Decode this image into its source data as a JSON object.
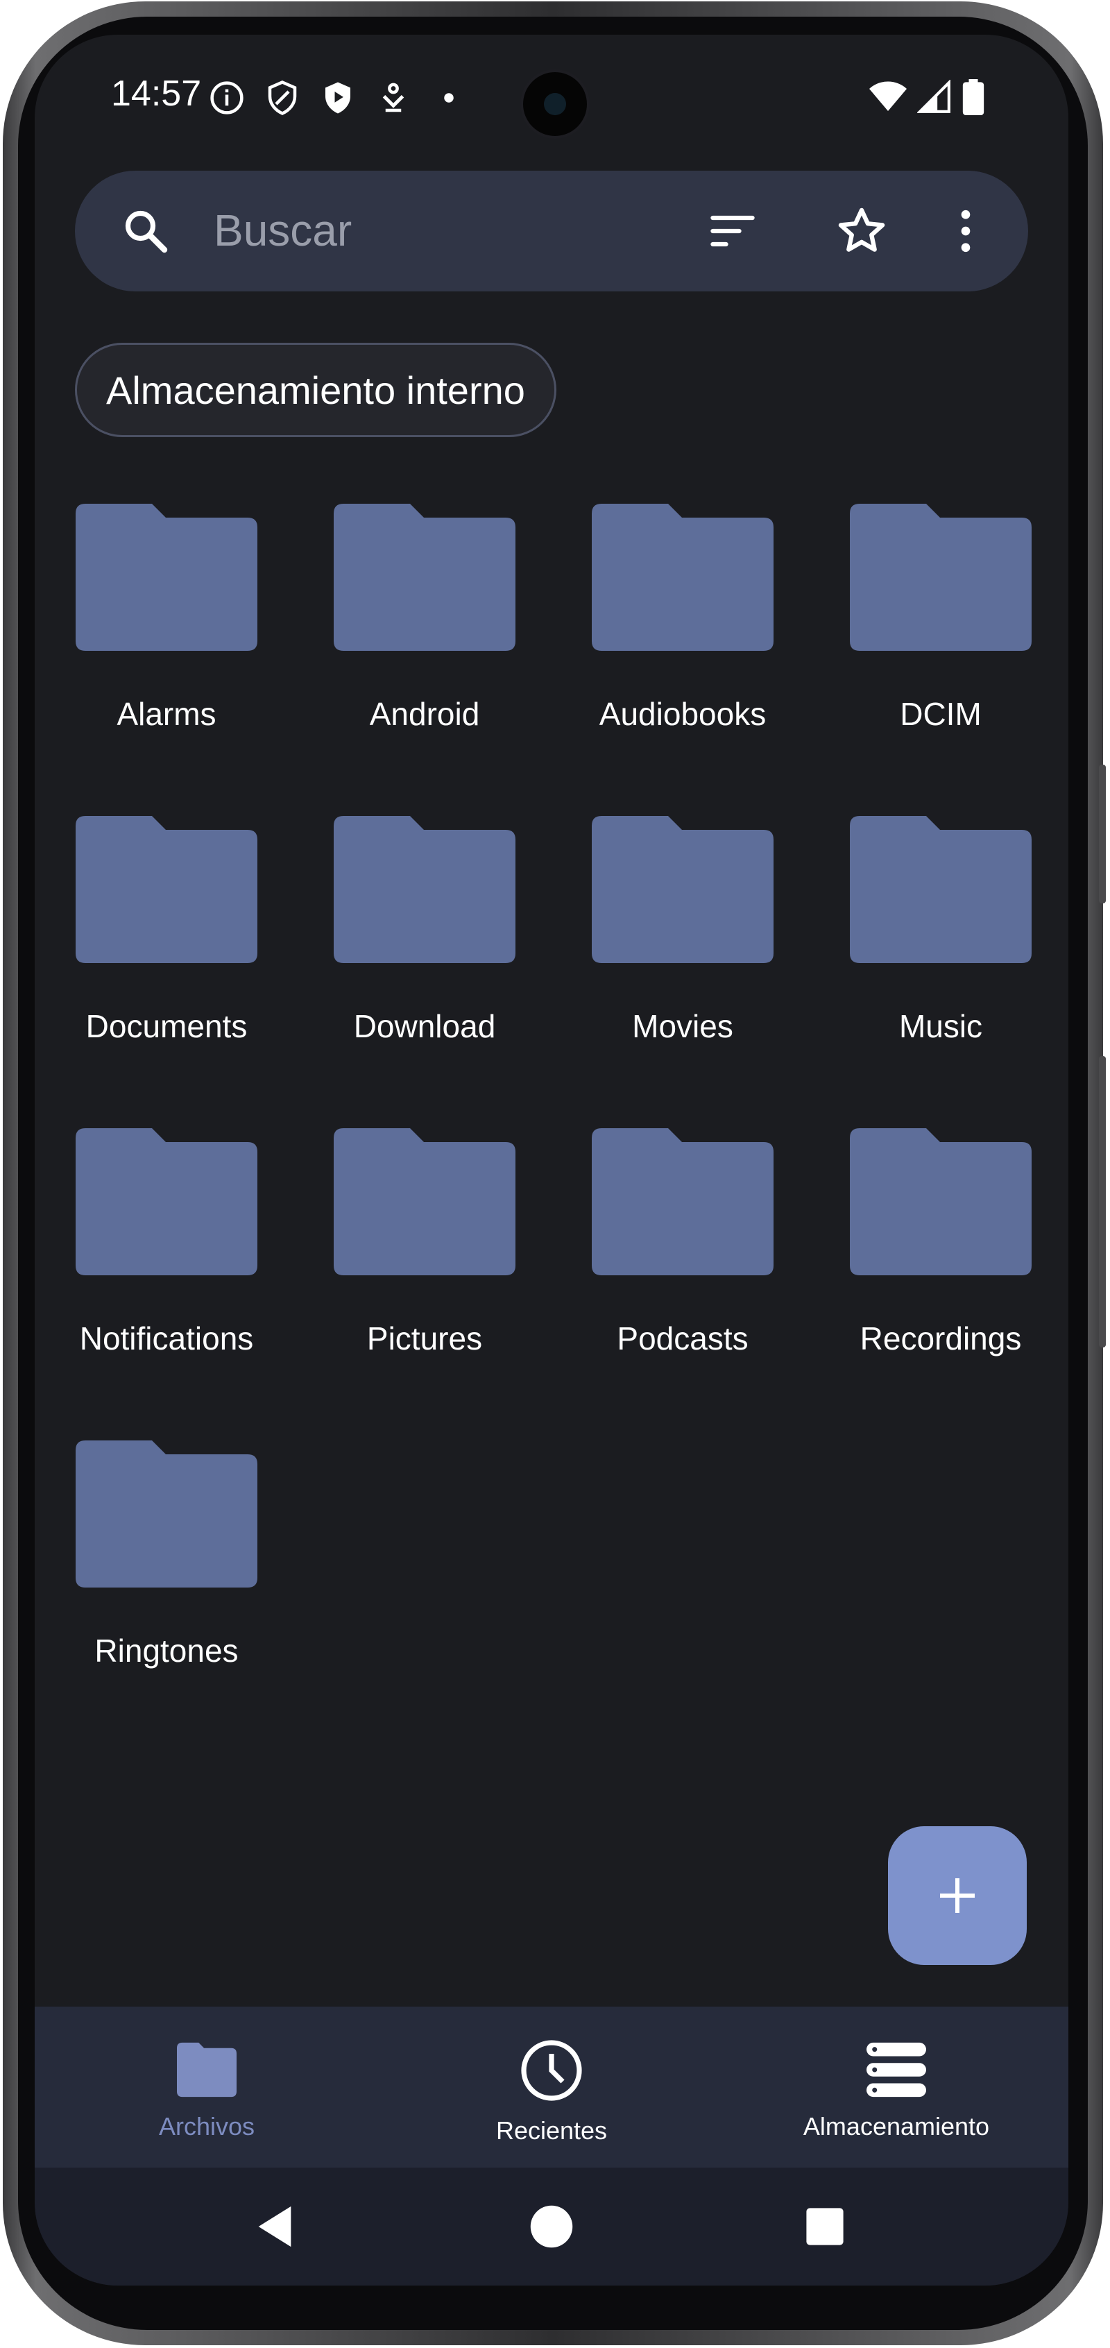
{
  "status_bar": {
    "time": "14:57",
    "icons": [
      "info-icon",
      "shield-icon",
      "play-shield-icon",
      "download-icon",
      "dot-icon"
    ],
    "right_icons": [
      "wifi-icon",
      "signal-icon",
      "battery-icon"
    ]
  },
  "search": {
    "placeholder": "Buscar",
    "icons": [
      "search-icon",
      "sort-icon",
      "star-icon",
      "more-icon"
    ]
  },
  "location_chip": "Almacenamiento interno",
  "folders": [
    "Alarms",
    "Android",
    "Audiobooks",
    "DCIM",
    "Documents",
    "Download",
    "Movies",
    "Music",
    "Notifications",
    "Pictures",
    "Podcasts",
    "Recordings",
    "Ringtones"
  ],
  "fab": {
    "icon": "plus-icon"
  },
  "bottom_nav": {
    "items": [
      {
        "label": "Archivos",
        "icon": "folder-icon",
        "active": true
      },
      {
        "label": "Recientes",
        "icon": "clock-icon",
        "active": false
      },
      {
        "label": "Almacenamiento",
        "icon": "storage-icon",
        "active": false
      }
    ]
  },
  "colors": {
    "background": "#1b1c20",
    "folder": "#5e6e9a",
    "accent": "#7e92cc",
    "search_bar": "#303546",
    "nav_bar": "#262b3b"
  }
}
